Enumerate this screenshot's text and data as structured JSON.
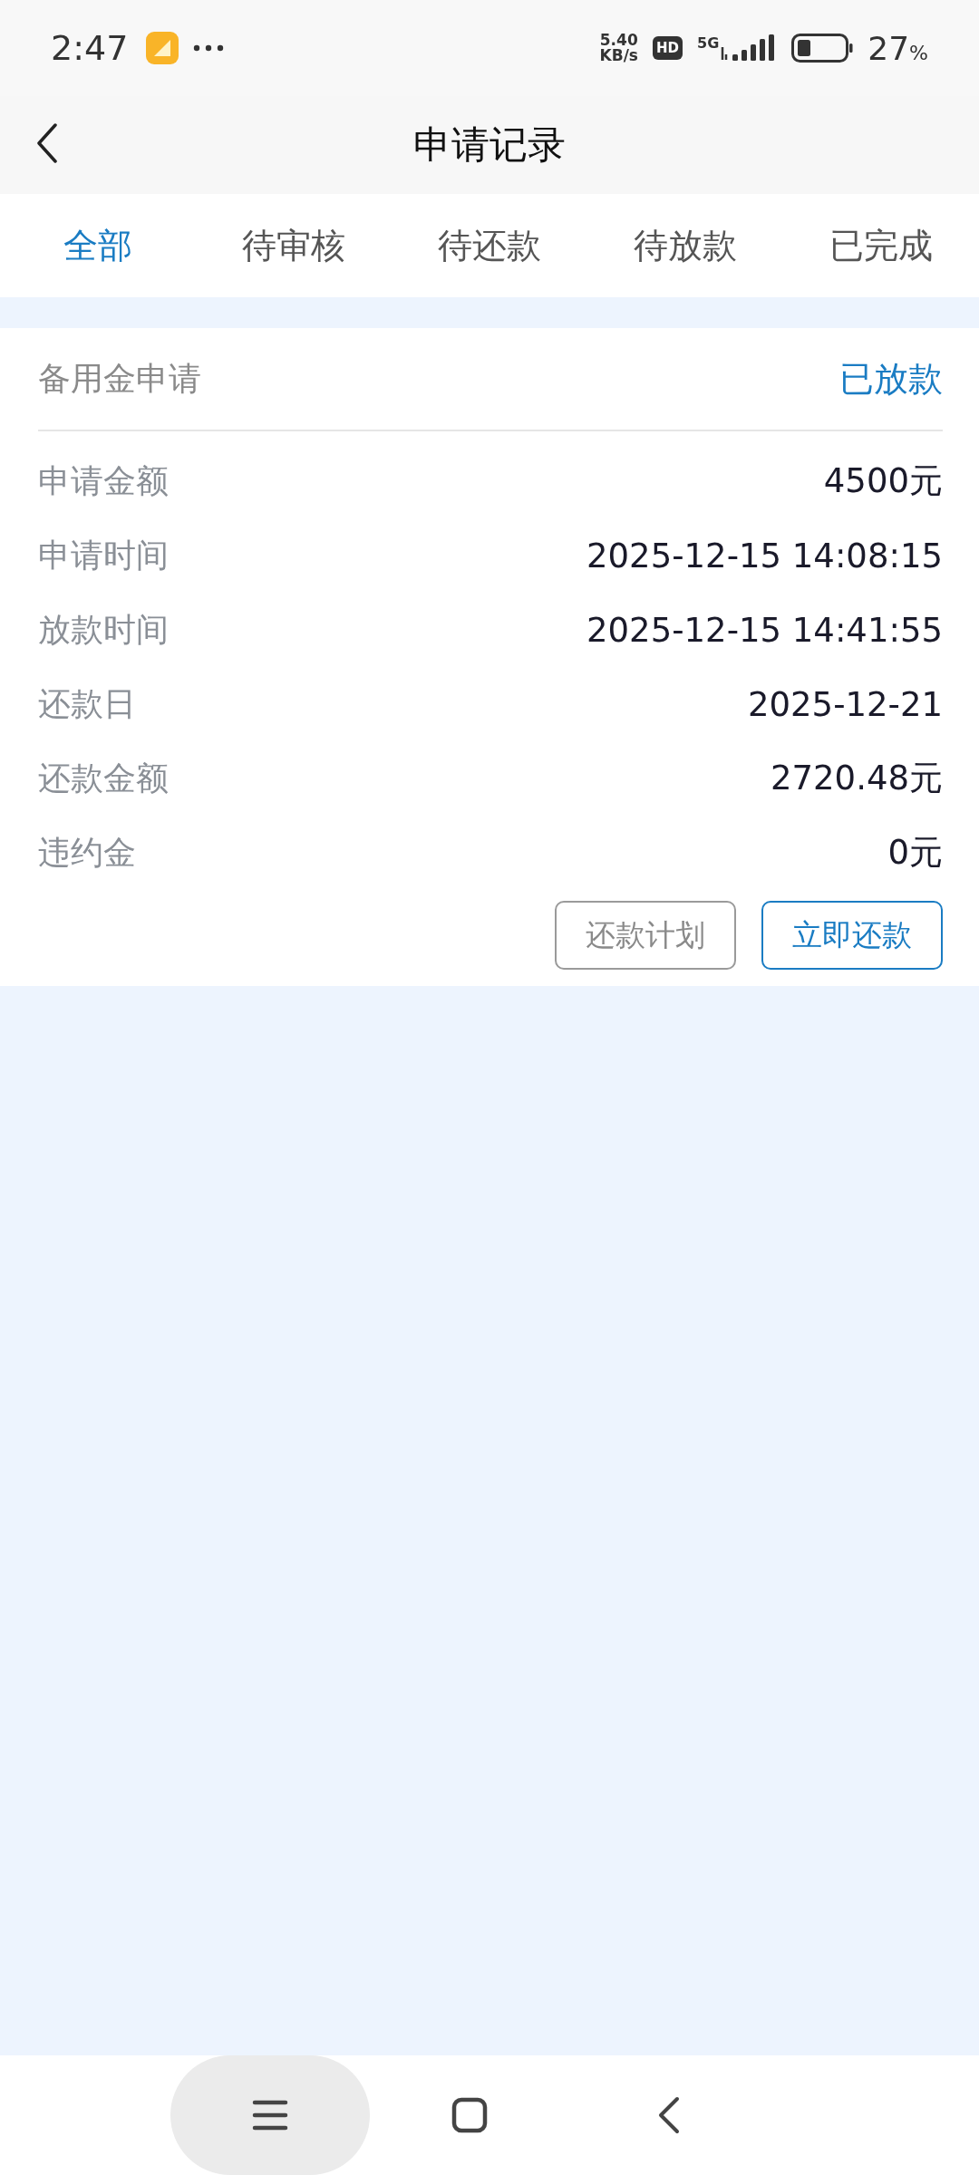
{
  "status_bar": {
    "time": "2:47",
    "net_speed_value": "5.40",
    "net_speed_unit": "KB/s",
    "hd": "HD",
    "network": "5G",
    "battery": "27",
    "battery_unit": "%"
  },
  "header": {
    "title": "申请记录"
  },
  "tabs": [
    {
      "label": "全部",
      "selected": true
    },
    {
      "label": "待审核",
      "selected": false
    },
    {
      "label": "待还款",
      "selected": false
    },
    {
      "label": "待放款",
      "selected": false
    },
    {
      "label": "已完成",
      "selected": false
    }
  ],
  "records": [
    {
      "title": "备用金申请",
      "status": "已放款",
      "fields": [
        {
          "label": "申请金额",
          "value": "4500元"
        },
        {
          "label": "申请时间",
          "value": "2025-12-15 14:08:15"
        },
        {
          "label": "放款时间",
          "value": "2025-12-15 14:41:55"
        },
        {
          "label": "还款日",
          "value": "2025-12-21"
        },
        {
          "label": "还款金额",
          "value": "2720.48元"
        },
        {
          "label": "违约金",
          "value": "0元"
        }
      ],
      "buttons": [
        {
          "label": "还款计划",
          "kind": "secondary"
        },
        {
          "label": "立即还款",
          "kind": "primary"
        }
      ]
    }
  ]
}
